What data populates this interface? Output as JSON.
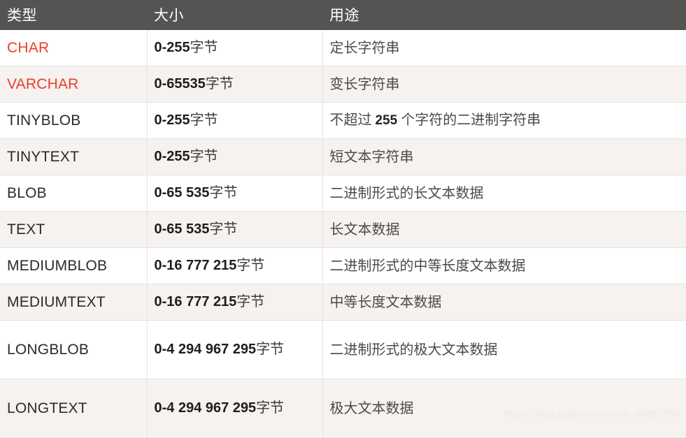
{
  "table": {
    "columns": [
      {
        "key": "type",
        "label": "类型"
      },
      {
        "key": "size",
        "label": "大小"
      },
      {
        "key": "usage",
        "label": "用途"
      }
    ],
    "accent_color": "#ee3d28",
    "header_background": "#565453",
    "row_even_background": "#f5f2f0",
    "row_odd_background": "#ffffff",
    "rows": [
      {
        "type": "CHAR",
        "size_number": "0-255",
        "size_unit": "字节",
        "usage": "定长字符串"
      },
      {
        "type": "VARCHAR",
        "size_number": "0-65535",
        "size_unit": "字节",
        "usage": "变长字符串"
      },
      {
        "type": "TINYBLOB",
        "size_number": "0-255",
        "size_unit": "字节",
        "usage_prefix": "不超过 ",
        "usage_number": "255",
        "usage_suffix": " 个字符的二进制字符串"
      },
      {
        "type": "TINYTEXT",
        "size_number": "0-255",
        "size_unit": "字节",
        "usage": "短文本字符串"
      },
      {
        "type": "BLOB",
        "size_number": "0-65 535",
        "size_unit": "字节",
        "usage": "二进制形式的长文本数据"
      },
      {
        "type": "TEXT",
        "size_number": "0-65 535",
        "size_unit": "字节",
        "usage": "长文本数据"
      },
      {
        "type": "MEDIUMBLOB",
        "size_number": "0-16 777 215",
        "size_unit": "字节",
        "usage": "二进制形式的中等长度文本数据"
      },
      {
        "type": "MEDIUMTEXT",
        "size_number": "0-16 777 215",
        "size_unit": "字节",
        "usage": "中等长度文本数据"
      },
      {
        "type": "LONGBLOB",
        "size_number": "0-4 294 967 295",
        "size_unit": "字节",
        "usage": "二进制形式的极大文本数据"
      },
      {
        "type": "LONGTEXT",
        "size_number": "0-4 294 967 295",
        "size_unit": "字节",
        "usage": "极大文本数据"
      }
    ]
  },
  "watermark": {
    "text": "https://blog.csdn.net/weixin_43691058"
  }
}
